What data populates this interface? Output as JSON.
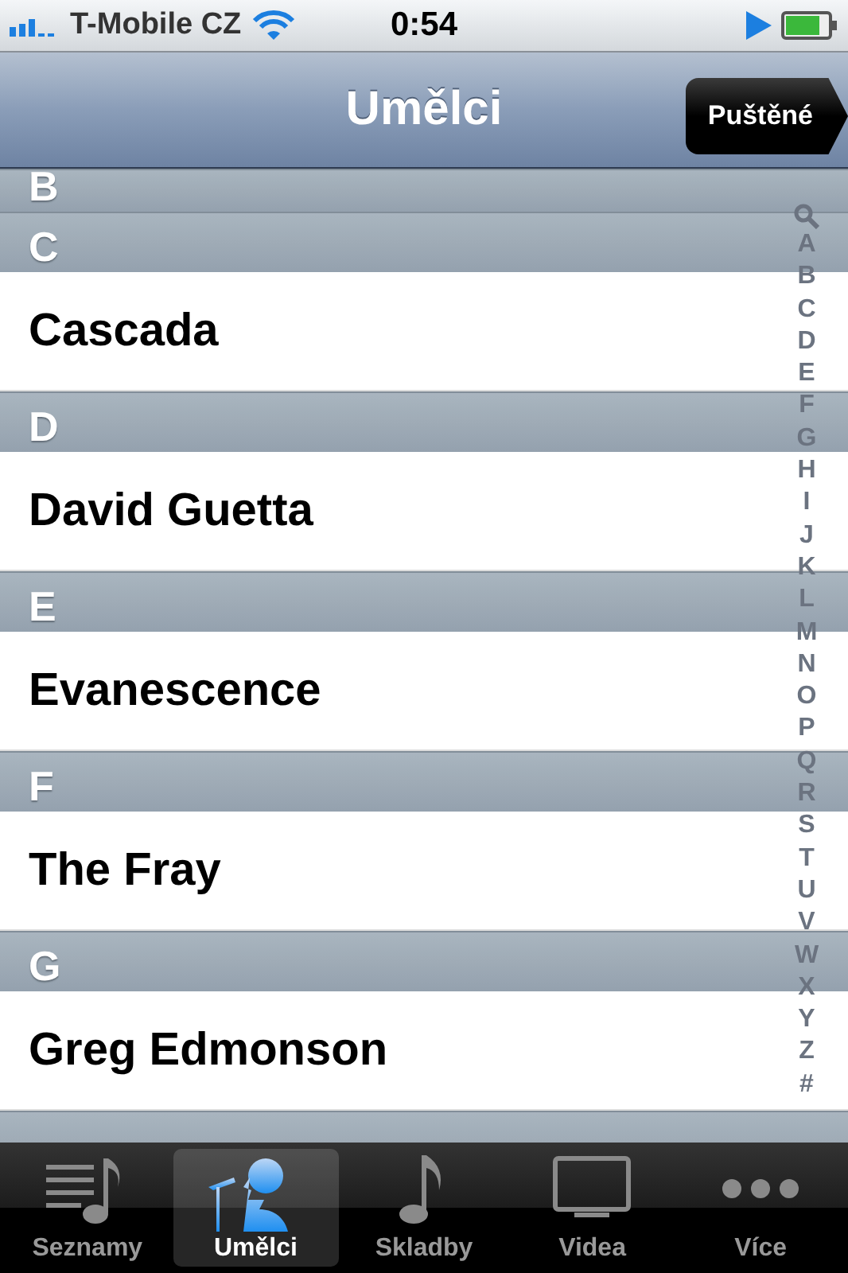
{
  "status_bar": {
    "carrier": "T-Mobile CZ",
    "time": "0:54"
  },
  "nav_bar": {
    "title": "Umělci",
    "now_playing_button": "Puštěné"
  },
  "sections": [
    {
      "letter": "B"
    },
    {
      "letter": "C",
      "artists": [
        "Cascada"
      ]
    },
    {
      "letter": "D",
      "artists": [
        "David Guetta"
      ]
    },
    {
      "letter": "E",
      "artists": [
        "Evanescence"
      ]
    },
    {
      "letter": "F",
      "artists": [
        "The Fray"
      ]
    },
    {
      "letter": "G",
      "artists": [
        "Greg Edmonson"
      ]
    }
  ],
  "index": [
    "A",
    "B",
    "C",
    "D",
    "E",
    "F",
    "G",
    "H",
    "I",
    "J",
    "K",
    "L",
    "M",
    "N",
    "O",
    "P",
    "Q",
    "R",
    "S",
    "T",
    "U",
    "V",
    "W",
    "X",
    "Y",
    "Z",
    "#"
  ],
  "tabs": [
    {
      "kind": "playlists",
      "label": "Seznamy",
      "selected": false
    },
    {
      "kind": "artists",
      "label": "Umělci",
      "selected": true
    },
    {
      "kind": "songs",
      "label": "Skladby",
      "selected": false
    },
    {
      "kind": "videos",
      "label": "Videa",
      "selected": false
    },
    {
      "kind": "more",
      "label": "Více",
      "selected": false
    }
  ]
}
